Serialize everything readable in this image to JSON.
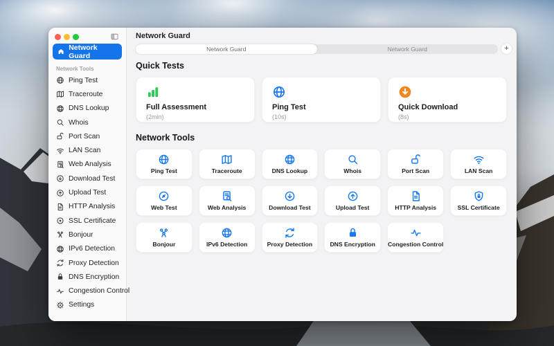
{
  "colors": {
    "accent": "#1574e9",
    "icon_blue": "#1778f2",
    "green": "#32c759",
    "orange": "#f0861f"
  },
  "window": {
    "title": "Network Guard"
  },
  "window_controls": {
    "close": "close-button",
    "minimize": "minimize-button",
    "zoom": "zoom-button"
  },
  "tabs": {
    "items": [
      {
        "label": "Network Guard",
        "active": true
      },
      {
        "label": "Network Guard",
        "active": false
      }
    ],
    "add_label": "+"
  },
  "sidebar": {
    "selected": {
      "label": "Network Guard",
      "icon": "house-icon"
    },
    "section_label": "Network Tools",
    "items": [
      {
        "label": "Ping Test",
        "icon": "globe-icon"
      },
      {
        "label": "Traceroute",
        "icon": "map-icon"
      },
      {
        "label": "DNS Lookup",
        "icon": "globe-grid-icon"
      },
      {
        "label": "Whois",
        "icon": "search-icon"
      },
      {
        "label": "Port Scan",
        "icon": "lock-open-icon"
      },
      {
        "label": "LAN Scan",
        "icon": "wifi-icon"
      },
      {
        "label": "Web Analysis",
        "icon": "document-search-icon"
      },
      {
        "label": "Download Test",
        "icon": "arrow-down-circle-icon"
      },
      {
        "label": "Upload Test",
        "icon": "arrow-up-circle-icon"
      },
      {
        "label": "HTTP Analysis",
        "icon": "document-icon"
      },
      {
        "label": "SSL Certificate",
        "icon": "seal-icon"
      },
      {
        "label": "Bonjour",
        "icon": "bonjour-icon"
      },
      {
        "label": "IPv6 Detection",
        "icon": "globe-grid-icon"
      },
      {
        "label": "Proxy Detection",
        "icon": "refresh-icon"
      },
      {
        "label": "DNS Encryption",
        "icon": "lock-icon"
      },
      {
        "label": "Congestion Control",
        "icon": "pulse-icon"
      }
    ],
    "footer": {
      "label": "Settings",
      "icon": "gear-icon"
    }
  },
  "quick_tests": {
    "heading": "Quick Tests",
    "cards": [
      {
        "title": "Full Assessment",
        "duration": "(2min)",
        "icon": "bar-chart-icon",
        "icon_color": "#32c759"
      },
      {
        "title": "Ping Test",
        "duration": "(10s)",
        "icon": "globe-icon",
        "icon_color": "#1778f2"
      },
      {
        "title": "Quick Download",
        "duration": "(8s)",
        "icon": "download-badge-icon",
        "icon_color": "#f0861f"
      }
    ]
  },
  "network_tools": {
    "heading": "Network Tools",
    "cards": [
      {
        "label": "Ping Test",
        "icon": "globe-icon"
      },
      {
        "label": "Traceroute",
        "icon": "map-icon"
      },
      {
        "label": "DNS Lookup",
        "icon": "globe-grid-icon"
      },
      {
        "label": "Whois",
        "icon": "search-icon"
      },
      {
        "label": "Port Scan",
        "icon": "lock-open-icon"
      },
      {
        "label": "LAN Scan",
        "icon": "wifi-icon"
      },
      {
        "label": "Web Test",
        "icon": "compass-icon"
      },
      {
        "label": "Web Analysis",
        "icon": "document-search-icon"
      },
      {
        "label": "Download Test",
        "icon": "arrow-down-circle-icon"
      },
      {
        "label": "Upload Test",
        "icon": "arrow-up-circle-icon"
      },
      {
        "label": "HTTP Analysis",
        "icon": "document-icon"
      },
      {
        "label": "SSL Certificate",
        "icon": "shield-lock-icon"
      },
      {
        "label": "Bonjour",
        "icon": "bonjour-icon"
      },
      {
        "label": "IPv6 Detection",
        "icon": "globe-grid-icon"
      },
      {
        "label": "Proxy Detection",
        "icon": "refresh-icon"
      },
      {
        "label": "DNS Encryption",
        "icon": "lock-icon"
      },
      {
        "label": "Congestion Control",
        "icon": "pulse-icon"
      }
    ]
  }
}
